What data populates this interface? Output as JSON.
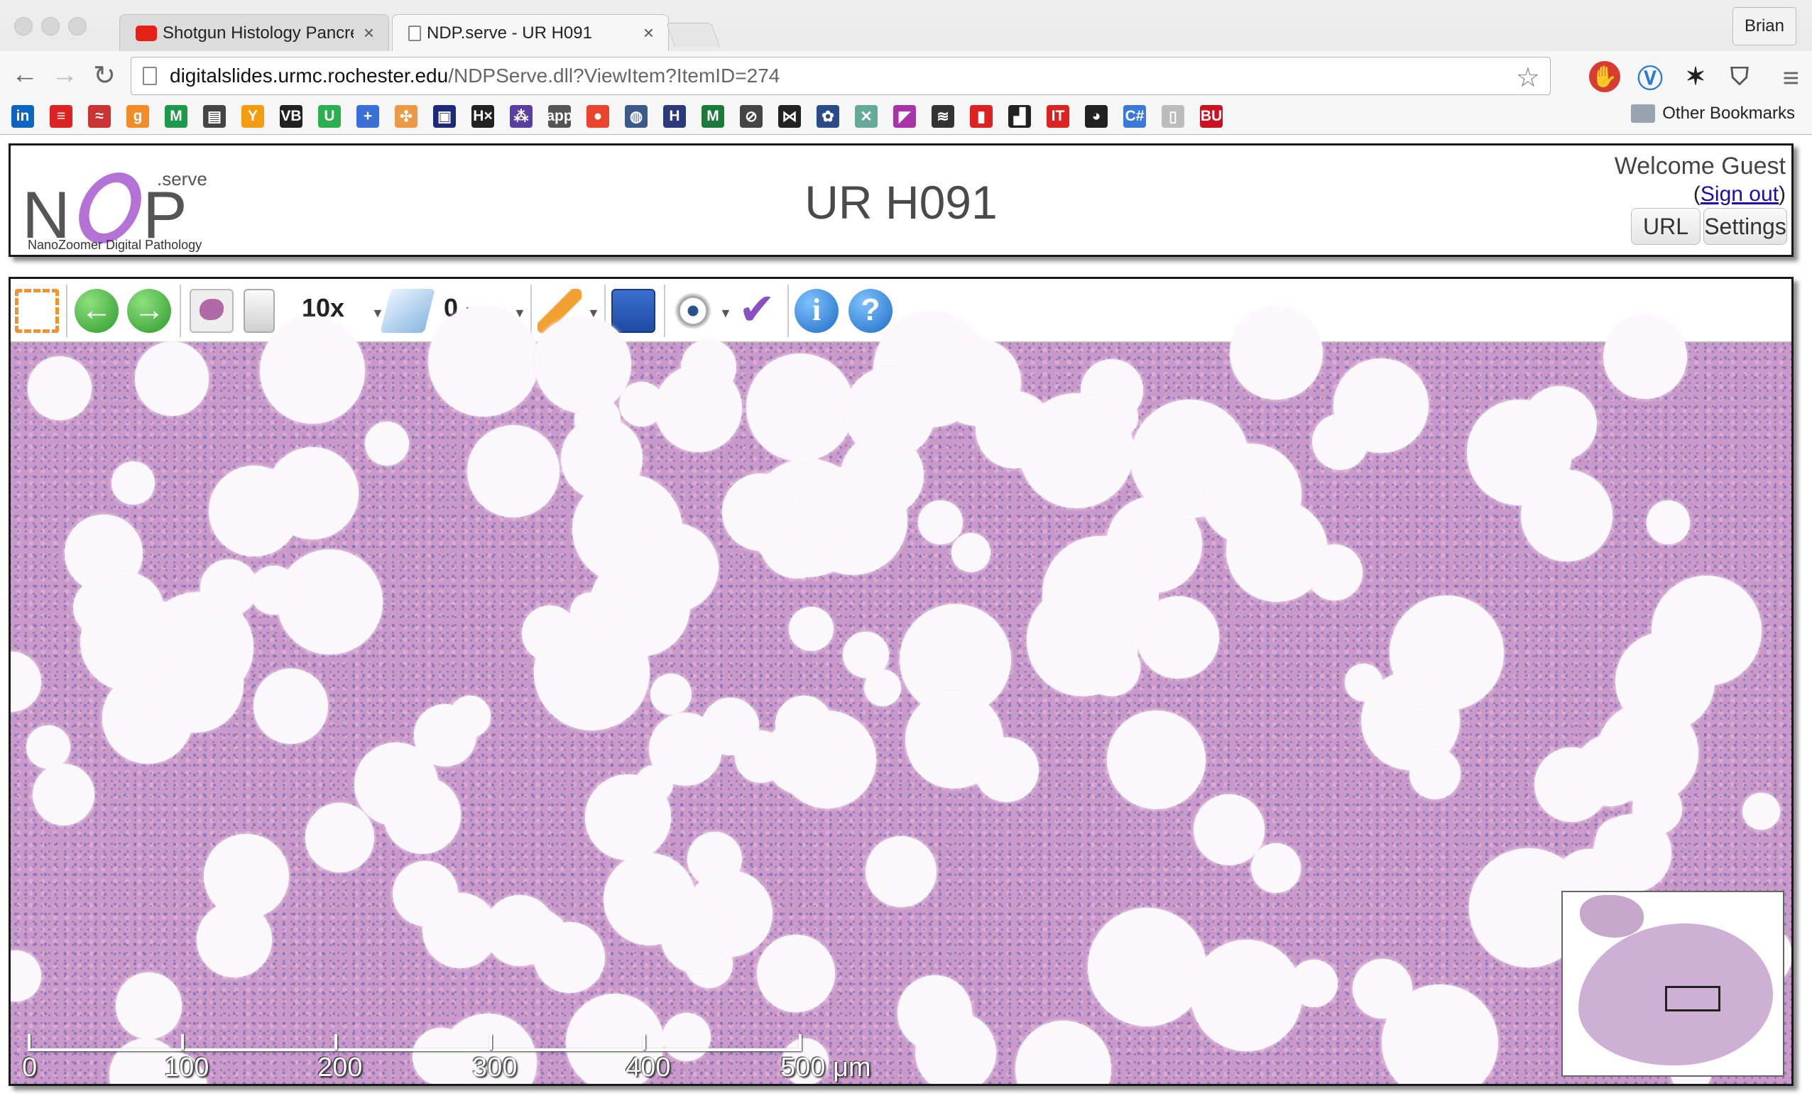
{
  "browser": {
    "tabs": [
      {
        "title": "Shotgun Histology Pancrea",
        "favicon": "youtube-icon",
        "active": false
      },
      {
        "title": "NDP.serve - UR H091",
        "favicon": "page-icon",
        "active": true
      }
    ],
    "profile_name": "Brian",
    "url_host": "digitalslides.urmc.rochester.edu",
    "url_path": "/NDPServe.dll?ViewItem?ItemID=274",
    "other_bookmarks": "Other Bookmarks",
    "bookmark_labels": [
      "in",
      "≡",
      "≈",
      "g",
      "M",
      "▤",
      "Y",
      "VB",
      "U",
      "+",
      "✣",
      "▣",
      "H×",
      "⁂",
      "app",
      "●",
      "◍",
      "H",
      "M",
      "⊘",
      "⋈",
      "✿",
      "✕",
      "◤",
      "≋",
      "▮",
      "▟",
      "IT",
      "◕",
      "C#",
      "▯",
      "BU"
    ]
  },
  "app": {
    "logo_text": "N P",
    "logo_serve": ".serve",
    "logo_tagline": "NanoZoomer Digital Pathology",
    "title": "UR H091",
    "welcome": "Welcome Guest",
    "signout_open": "(",
    "signout_label": "Sign out",
    "signout_close": ")",
    "url_button": "URL",
    "settings_button": "Settings"
  },
  "viewer": {
    "magnification": "10x",
    "focus": "0",
    "focus_unit": "μm",
    "scale_labels": [
      "0",
      "100",
      "200",
      "300",
      "400",
      "500 μm"
    ]
  },
  "colors": {
    "tissue_pink": "#c99ac9",
    "nuclei_blue": "#5a64b4",
    "logo_purple": "#b572d6",
    "link_blue": "#1a0dab"
  }
}
